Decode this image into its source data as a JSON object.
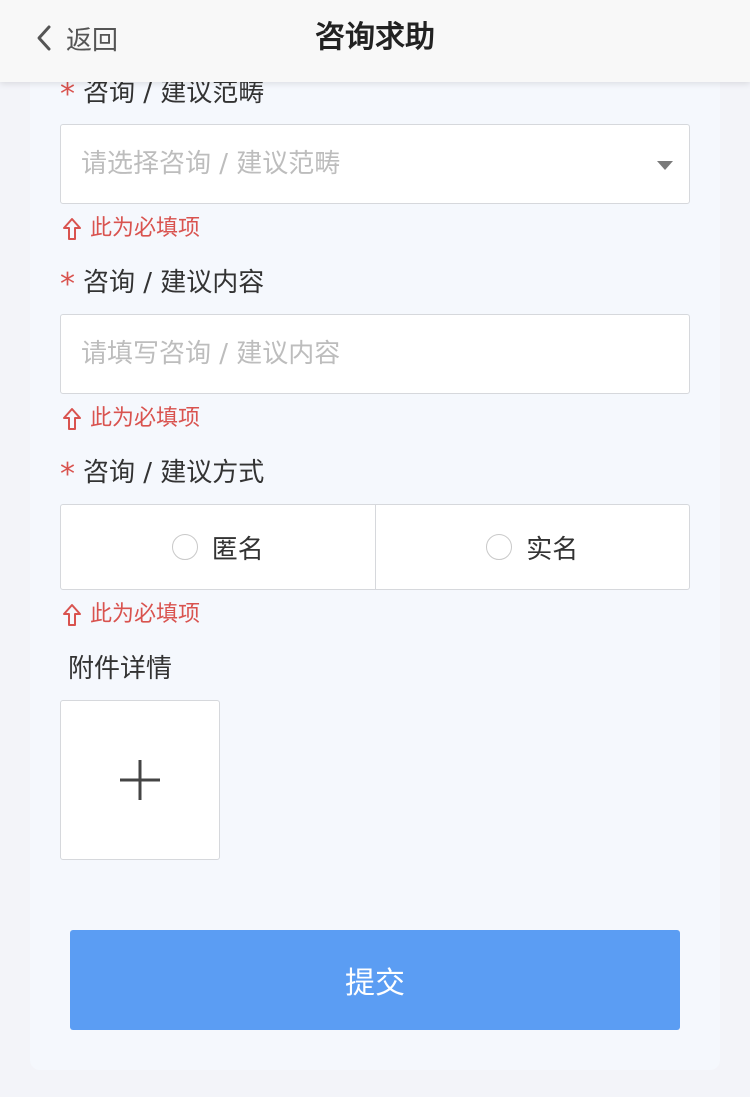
{
  "nav": {
    "back_label": "返回",
    "title": "咨询求助"
  },
  "form": {
    "category": {
      "required_mark": "*",
      "label": "咨询 / 建议范畴",
      "placeholder": "请选择咨询 / 建议范畴",
      "error": "此为必填项"
    },
    "content": {
      "required_mark": "*",
      "label": "咨询 / 建议内容",
      "placeholder": "请填写咨询 / 建议内容",
      "error": "此为必填项"
    },
    "method": {
      "required_mark": "*",
      "label": "咨询 / 建议方式",
      "options": [
        "匿名",
        "实名"
      ],
      "error": "此为必填项"
    },
    "attachment": {
      "label": "附件详情"
    },
    "submit_label": "提交"
  },
  "colors": {
    "accent": "#5b9df3",
    "error": "#d9534f",
    "background": "#f3f4f9"
  },
  "icons": {
    "back": "chevron-left-icon",
    "dropdown": "caret-down-icon",
    "error": "arrow-up-outline-icon",
    "upload": "plus-icon"
  }
}
